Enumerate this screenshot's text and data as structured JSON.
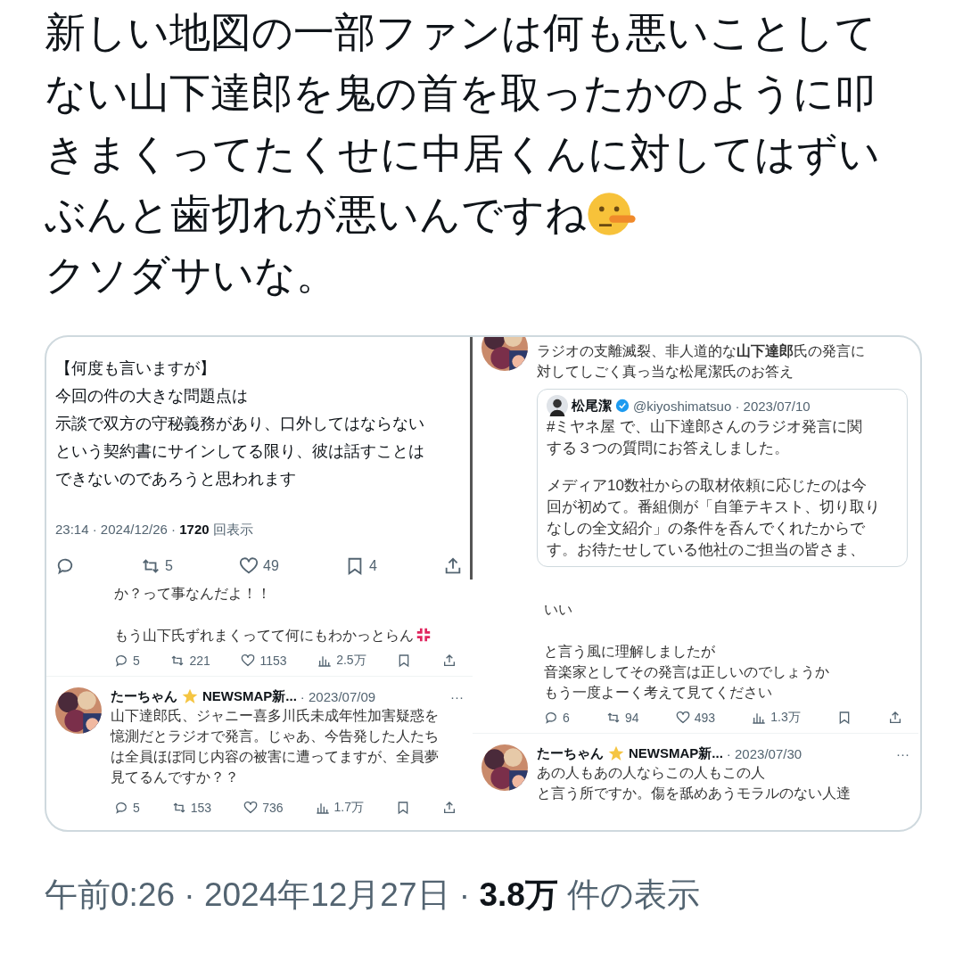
{
  "tweet": {
    "text": "新しい地図の一部ファンは何も悪いことしてない山下達郎を鬼の首を取ったかのように叩きまくってたくせに中居くんに対してはずい",
    "text_emoji_line": "ぶんと歯切れが悪いんですね",
    "text_after": "クソダサいな。"
  },
  "collage": {
    "top_left": {
      "body": [
        [
          "【何度も言いますが】",
          "今回の件の大きな問題点は",
          "示談で双方の守秘義務があり、口外してはならない",
          "という契約書にサインしてる限り、彼は話すことは",
          "できないのであろうと思われます"
        ]
      ],
      "meta": "23:14 · 2024/12/26 ·",
      "views": "1720",
      "views_label": "回表示",
      "actions": [
        {
          "kind": "reply"
        },
        {
          "kind": "retweet",
          "count": "5"
        },
        {
          "kind": "like",
          "count": "49"
        },
        {
          "kind": "bookmark",
          "count": "4"
        },
        {
          "kind": "share"
        }
      ]
    },
    "top_right": {
      "body": [
        [
          "ラジオの支離滅裂、非人道的な**山下達郎**氏の発言に",
          "対してしごく真っ当な松尾潔氏のお答え"
        ]
      ],
      "quote": {
        "name": "松尾潔",
        "handle": "@kiyoshimatsuo · 2023/07/10",
        "body": [
          [
            "#ミヤネ屋 で、山下達郎さんのラジオ発言に関",
            "する３つの質問にお答えしました。"
          ],
          [
            "メディア10数社からの取材依頼に応じたのは今",
            "回が初めて。番組側が「自筆テキスト、切り取り",
            "なしの全文紹介」の条件を呑んでくれたからで",
            "す。お待たせしている他社のご担当の皆さま、"
          ]
        ]
      }
    },
    "bottom_left": {
      "body": [
        [
          "か？って事なんだよ！！"
        ],
        [
          "もう山下氏ずれまくってて何にもわかっとらん"
        ]
      ],
      "actions": [
        {
          "kind": "reply",
          "count": "5"
        },
        {
          "kind": "retweet",
          "count": "221"
        },
        {
          "kind": "like",
          "count": "1153"
        },
        {
          "kind": "views",
          "count": "2.5万"
        },
        {
          "kind": "bookmark"
        },
        {
          "kind": "share"
        }
      ],
      "post": {
        "name": "たーちゃん",
        "name_rest": "NEWSMAP新...",
        "date": "· 2023/07/09",
        "more": "···",
        "body": [
          [
            "山下達郎氏、ジャニー喜多川氏未成年性加害疑惑を",
            "憶測だとラジオで発言。じゃあ、今告発した人たち",
            "は全員ほぼ同じ内容の被害に遭ってますが、全員夢",
            "見てるんですか？？"
          ]
        ],
        "actions": [
          {
            "kind": "reply",
            "count": "5"
          },
          {
            "kind": "retweet",
            "count": "153"
          },
          {
            "kind": "like",
            "count": "736"
          },
          {
            "kind": "views",
            "count": "1.7万"
          },
          {
            "kind": "bookmark"
          },
          {
            "kind": "share"
          }
        ]
      }
    },
    "bottom_right": {
      "body": [
        [
          "いい"
        ],
        [
          "と言う風に理解しましたが",
          "音楽家としてその発言は正しいのでしょうか",
          "もう一度よーく考えて見てください"
        ]
      ],
      "actions": [
        {
          "kind": "reply",
          "count": "6"
        },
        {
          "kind": "retweet",
          "count": "94"
        },
        {
          "kind": "like",
          "count": "493"
        },
        {
          "kind": "views",
          "count": "1.3万"
        },
        {
          "kind": "bookmark"
        },
        {
          "kind": "share"
        }
      ],
      "post": {
        "name": "たーちゃん",
        "name_rest": "NEWSMAP新...",
        "date": "· 2023/07/30",
        "more": "···",
        "body": [
          [
            "あの人もあの人ならこの人もこの人",
            "と言う所ですか。傷を舐めあうモラルのない人達"
          ]
        ]
      }
    }
  },
  "footer": {
    "time": "午前0:26 · 2024年12月27日 ·",
    "views": "3.8万",
    "views_label": "件の表示"
  }
}
